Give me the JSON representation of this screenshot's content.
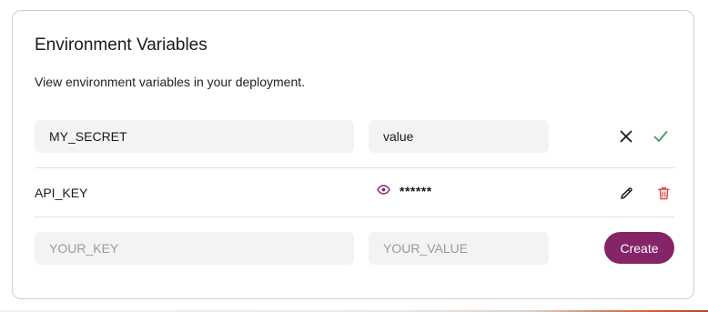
{
  "section": {
    "title": "Environment Variables",
    "description": "View environment variables in your deployment."
  },
  "editing_row": {
    "key_value": "MY_SECRET",
    "value_value": "value",
    "cancel_icon": "close-icon",
    "confirm_icon": "check-icon"
  },
  "saved_rows": [
    {
      "key": "API_KEY",
      "masked_value": "******",
      "reveal_icon": "eye-icon",
      "edit_icon": "pencil-icon",
      "delete_icon": "trash-icon"
    }
  ],
  "new_row": {
    "key_placeholder": "YOUR_KEY",
    "value_placeholder": "YOUR_VALUE",
    "create_label": "Create"
  },
  "colors": {
    "accent": "#862468",
    "confirm": "#3aa35a",
    "danger": "#d64545",
    "eye": "#862468"
  }
}
